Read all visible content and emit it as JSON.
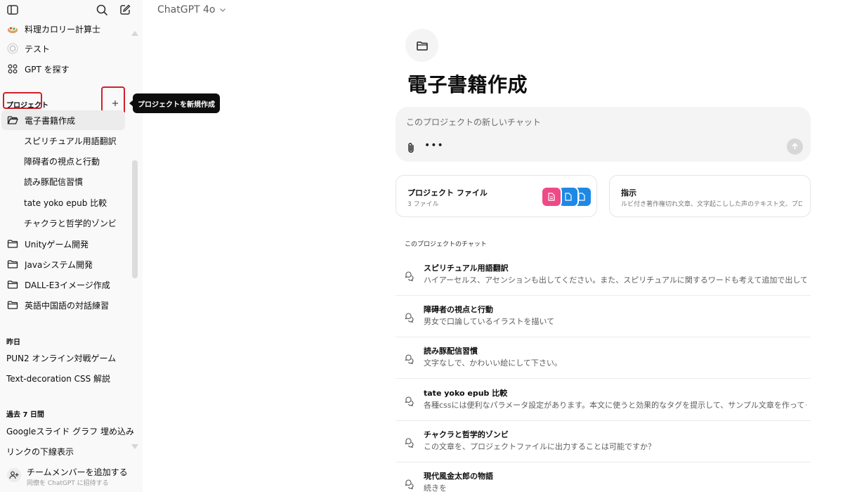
{
  "header": {
    "model_name": "ChatGPT 4o"
  },
  "sidebar": {
    "gpts": [
      {
        "label": "料理カロリー計算士",
        "icon": "calorie-gpt-avatar-icon"
      },
      {
        "label": "テスト",
        "icon": "cube-icon"
      },
      {
        "label": "GPT を探す",
        "icon": "grid-icon"
      }
    ],
    "projects_label": "プロジェクト",
    "new_project_tooltip": "プロジェクトを新規作成",
    "active_project": "電子書籍作成",
    "active_project_chats": [
      "スピリチュアル用語翻訳",
      "障碍者の視点と行動",
      "読み豚配信習慣",
      "tate yoko epub 比較",
      "チャクラと哲学的ゾンビ"
    ],
    "other_projects": [
      "Unityゲーム開発",
      "Javaシステム開発",
      "DALL-E3イメージ作成",
      "英語中国語の対話練習"
    ],
    "yesterday_label": "昨日",
    "yesterday_items": [
      "PUN2 オンライン対戦ゲーム",
      "Text-decoration CSS 解説"
    ],
    "last7_label": "過去 7 日間",
    "last7_items": [
      "Googleスライド グラフ 埋め込み",
      "リンクの下線表示"
    ],
    "team": {
      "title": "チームメンバーを追加する",
      "subtitle": "同僚を ChatGPT に招待する"
    }
  },
  "main": {
    "project_title": "電子書籍作成",
    "composer_placeholder": "このプロジェクトの新しいチャット",
    "files_card": {
      "title": "プロジェクト ファイル",
      "count": "3 ファイル"
    },
    "instructions_card": {
      "title": "指示",
      "preview": "ルビ付き著作権切れ文章、文字起こしした声のテキスト文、プロ..."
    },
    "chats_heading": "このプロジェクトのチャット",
    "chats": [
      {
        "title": "スピリチュアル用語翻訳",
        "snippet": "ハイアーセルス、アセンションも出してください。また、スピリチュアルに関するワードも考えて追加で出してください。"
      },
      {
        "title": "障碍者の視点と行動",
        "snippet": "男女で口論しているイラストを描いて"
      },
      {
        "title": "読み豚配信習慣",
        "snippet": "文字なしで、かわいい絵にして下さい。"
      },
      {
        "title": "tate yoko epub 比較",
        "snippet": "各種cssには便利なパラメータ設定があります。本文に使うと効果的なタグを提示して、サンプル文章を作ってください"
      },
      {
        "title": "チャクラと哲学的ゾンビ",
        "snippet": "この文章を、プロジェクトファイルに出力することは可能ですか？"
      },
      {
        "title": "現代風金太郎の物語",
        "snippet": "続きを"
      }
    ]
  },
  "colors": {
    "highlight_box": "#d0202a",
    "file_pink": "#ee4b86",
    "file_blue": "#1e88e5"
  }
}
